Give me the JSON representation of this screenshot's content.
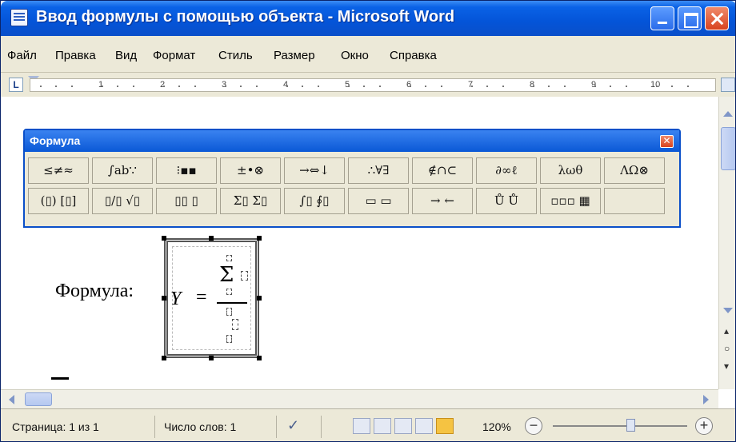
{
  "window": {
    "title": "Ввод формулы с помощью объекта - Microsoft Word"
  },
  "menu": {
    "items": [
      "Файл",
      "Правка",
      "Вид",
      "Формат",
      "Стиль",
      "Размер",
      "Окно",
      "Справка"
    ]
  },
  "ruler": {
    "tab_marker": "L",
    "numbers": [
      "1",
      "2",
      "3",
      "4",
      "5",
      "6",
      "7",
      "8",
      "9",
      "10"
    ]
  },
  "palette": {
    "title": "Формула",
    "row1": [
      "≤≠≈",
      "∫ab∵",
      "⁝▪▪",
      "±•⊗",
      "→⇔↓",
      "∴∀∃",
      "∉∩⊂",
      "∂∞ℓ",
      "λωθ",
      "ΛΩ⊗"
    ],
    "row2": [
      "(▯) [▯]",
      "▯/▯ √▯",
      "▯▯ ▯",
      "Σ▯ Σ▯",
      "∫▯ ∮▯",
      "▭ ▭",
      "→ ←",
      "Ů Ů",
      "▫▫▫ ▦"
    ]
  },
  "document": {
    "formula_label": "Формула:",
    "equation": {
      "lhs": "Y",
      "equals": "=",
      "numerator_symbol": "Σ"
    }
  },
  "status": {
    "page": "Страница: 1 из 1",
    "words": "Число слов: 1",
    "zoom": "120%",
    "zoom_minus": "−",
    "zoom_plus": "+"
  },
  "icons": {
    "app": "word-document-icon",
    "spell": "spellcheck-icon"
  },
  "colors": {
    "titlebar": "#0454d8",
    "chrome": "#ece9d8",
    "active_view": "#f5c342"
  }
}
